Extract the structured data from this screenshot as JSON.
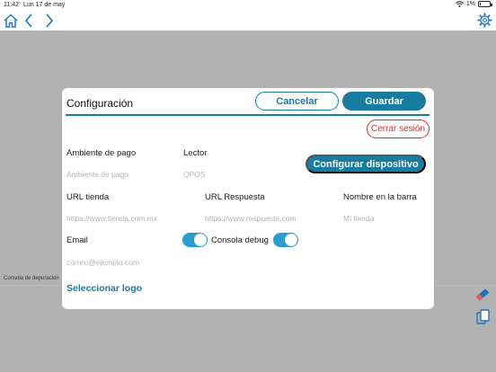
{
  "status_bar": {
    "time": "11:42",
    "date": "Lun 17 de may",
    "battery_percent": "1%"
  },
  "background": {
    "section_label": "Consola de depuración"
  },
  "modal": {
    "title": "Configuración",
    "cancel_label": "Cancelar",
    "save_label": "Guardar",
    "logout_label": "Cerrar sesión",
    "configure_device_label": "Configurar dispositivo",
    "fields": {
      "payment_env": {
        "label": "Ambiente de pago",
        "placeholder": "Ambiente de pago"
      },
      "reader": {
        "label": "Lector",
        "placeholder": "QPOS"
      },
      "store_url": {
        "label": "URL tienda",
        "placeholder": "https://www.tienda.com.mx"
      },
      "response_url": {
        "label": "URL Respuesta",
        "placeholder": "https://www.respuesta.com"
      },
      "bar_name": {
        "label": "Nombre en la barra",
        "placeholder": "Mi tienda"
      },
      "email": {
        "label": "Email",
        "placeholder": "correo@ejemplo.com"
      }
    },
    "email_toggle_on": true,
    "debug_console": {
      "label": "Consola debug",
      "on": true
    },
    "select_logo_label": "Seleccionar logo"
  },
  "colors": {
    "accent": "#167ca0",
    "toggle": "#2a9fcf",
    "danger": "#d32f2f"
  },
  "icons": [
    "home-icon",
    "back-chevron-icon",
    "forward-chevron-icon",
    "gear-icon",
    "eraser-icon",
    "copy-icon",
    "wifi-icon",
    "battery-icon"
  ]
}
